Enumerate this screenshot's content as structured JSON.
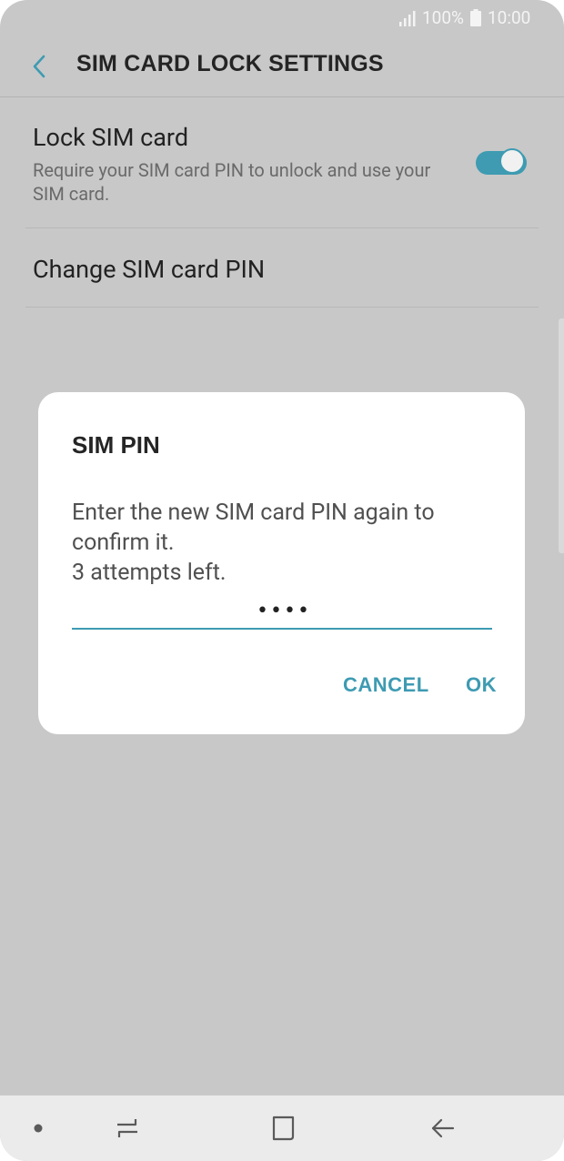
{
  "status_bar": {
    "battery_percent": "100%",
    "time": "10:00",
    "icons": [
      "signal-icon",
      "battery-icon"
    ]
  },
  "header": {
    "title": "SIM CARD LOCK SETTINGS",
    "back_icon": "back-arrow-icon"
  },
  "settings": {
    "lock_sim": {
      "title": "Lock SIM card",
      "summary": "Require your SIM card PIN to unlock and use your SIM card.",
      "enabled": true
    },
    "change_pin": {
      "title": "Change SIM card PIN"
    }
  },
  "dialog": {
    "title": "SIM PIN",
    "message": "Enter the new SIM card PIN again to confirm it.\n3 attempts left.",
    "pin_value": "••••",
    "cancel_label": "CANCEL",
    "ok_label": "OK"
  },
  "nav_bar": {
    "icons": [
      "nav-dot-icon",
      "recent-apps-icon",
      "home-icon",
      "back-icon"
    ]
  },
  "colors": {
    "accent": "#3e9bb2",
    "scrim_background": "#c8c8c8",
    "dialog_background": "#ffffff",
    "nav_background": "#ebebeb"
  }
}
